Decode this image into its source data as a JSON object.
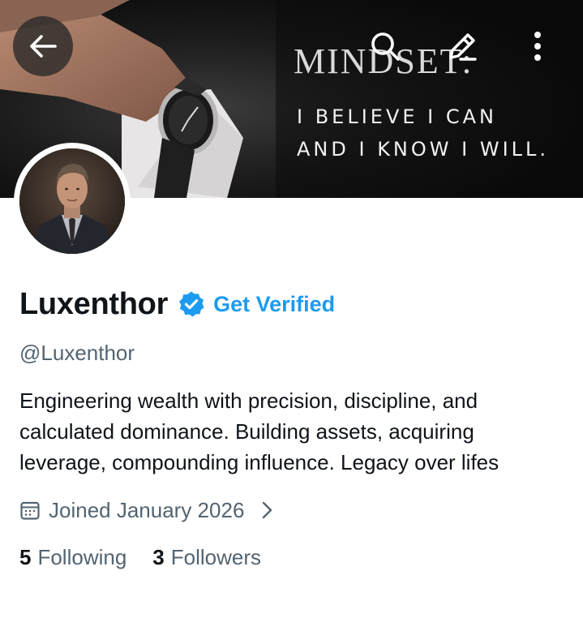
{
  "banner": {
    "title": "MINDSET:",
    "line1": "I BELIEVE I CAN",
    "line2": "AND I KNOW I WILL."
  },
  "icons": {
    "back": "arrow-left-icon",
    "search": "search-icon",
    "edit": "pencil-icon",
    "more": "more-vertical-icon",
    "verified": "verified-badge-icon",
    "calendar": "calendar-icon",
    "chevron": "chevron-right-icon"
  },
  "profile": {
    "name": "Luxenthor",
    "get_verified": "Get Verified",
    "handle": "@Luxenthor",
    "bio_lines": [
      "Engineering wealth with precision, discipline, and",
      "calculated dominance. Building assets, acquiring",
      "leverage, compounding influence. Legacy over lifes"
    ],
    "joined": "Joined January 2026",
    "following_count": "5",
    "following_label": "Following",
    "followers_count": "3",
    "followers_label": "Followers"
  },
  "colors": {
    "accent": "#1d9bf0",
    "secondary_text": "#536471",
    "primary_text": "#0f1419"
  }
}
